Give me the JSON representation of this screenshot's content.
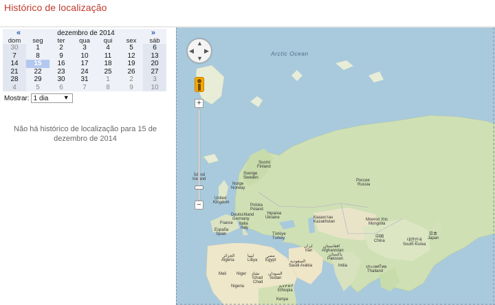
{
  "page": {
    "title": "Histórico de localização"
  },
  "calendar": {
    "prev": "«",
    "next": "»",
    "month_title": "dezembro de 2014",
    "weekdays": [
      "dom",
      "seg",
      "ter",
      "qua",
      "qui",
      "sex",
      "sáb"
    ],
    "weeks": [
      [
        "30",
        "1",
        "2",
        "3",
        "4",
        "5",
        "6"
      ],
      [
        "7",
        "8",
        "9",
        "10",
        "11",
        "12",
        "13"
      ],
      [
        "14",
        "15",
        "16",
        "17",
        "18",
        "19",
        "20"
      ],
      [
        "21",
        "22",
        "23",
        "24",
        "25",
        "26",
        "27"
      ],
      [
        "28",
        "29",
        "30",
        "31",
        "1",
        "2",
        "3"
      ],
      [
        "4",
        "5",
        "6",
        "7",
        "8",
        "9",
        "10"
      ]
    ],
    "selected": "15"
  },
  "show": {
    "label": "Mostrar:",
    "value": "1 dia"
  },
  "message": "Não há histórico de localização para 15 de dezembro de 2014",
  "map": {
    "ocean": "Arctic Ocean",
    "zoom_in": "+",
    "zoom_out": "−",
    "labels": {
      "suomi": "Suomi",
      "finland": "Finland",
      "sverige": "Sverige",
      "sweden": "Sweden",
      "norge": "Norge",
      "norway": "Norway",
      "island": "Ísland",
      "iceland": "Iceland",
      "uk1": "United",
      "uk2": "Kingdom",
      "deutschland": "Deutschland",
      "germany": "Germany",
      "polska": "Polska",
      "poland": "Poland",
      "ukraine_local": "Україна",
      "ukraine": "Ukraine",
      "france": "France",
      "italia": "Italia",
      "italy": "Italy",
      "espana": "España",
      "spain": "Spain",
      "turkiye": "Türkiye",
      "turkey": "Turkey",
      "kz_local": "Казахстан",
      "kazakhstan": "Kazakhstan",
      "ru_local": "Россия",
      "russia": "Russia",
      "mn_local": "Монгол Улс",
      "mongolia": "Mongolia",
      "china_local": "中国",
      "china": "China",
      "japan_local": "日本",
      "japan": "Japan",
      "korea_local": "대한민국",
      "south_korea": "South Korea",
      "af_local": "افغانستان",
      "afghanistan": "Afghanistan",
      "pk_local": "پاکستان",
      "pakistan": "Pakistan",
      "ir_local": "ایران",
      "iran": "Iran",
      "sa_local": "السعودية",
      "saudi": "Saudi Arabia",
      "india": "India",
      "th_local": "ประเทศไทย",
      "thailand": "Thailand",
      "algeria_local": "الجزائر",
      "algeria": "Algeria",
      "libya_local": "ليبيا",
      "libya": "Libya",
      "egypt_local": "مصر",
      "egypt": "Egypt",
      "mali": "Mali",
      "niger": "Niger",
      "tchad_local": "تشاد",
      "chad": "Tchad",
      "chad2": "Chad",
      "sudan_local": "السودان",
      "sudan": "Sudan",
      "nigeria": "Nigeria",
      "ethiopia_local": "ኢትዮጵያ",
      "ethiopia": "Ethiopia",
      "kenya": "Kenya"
    }
  }
}
